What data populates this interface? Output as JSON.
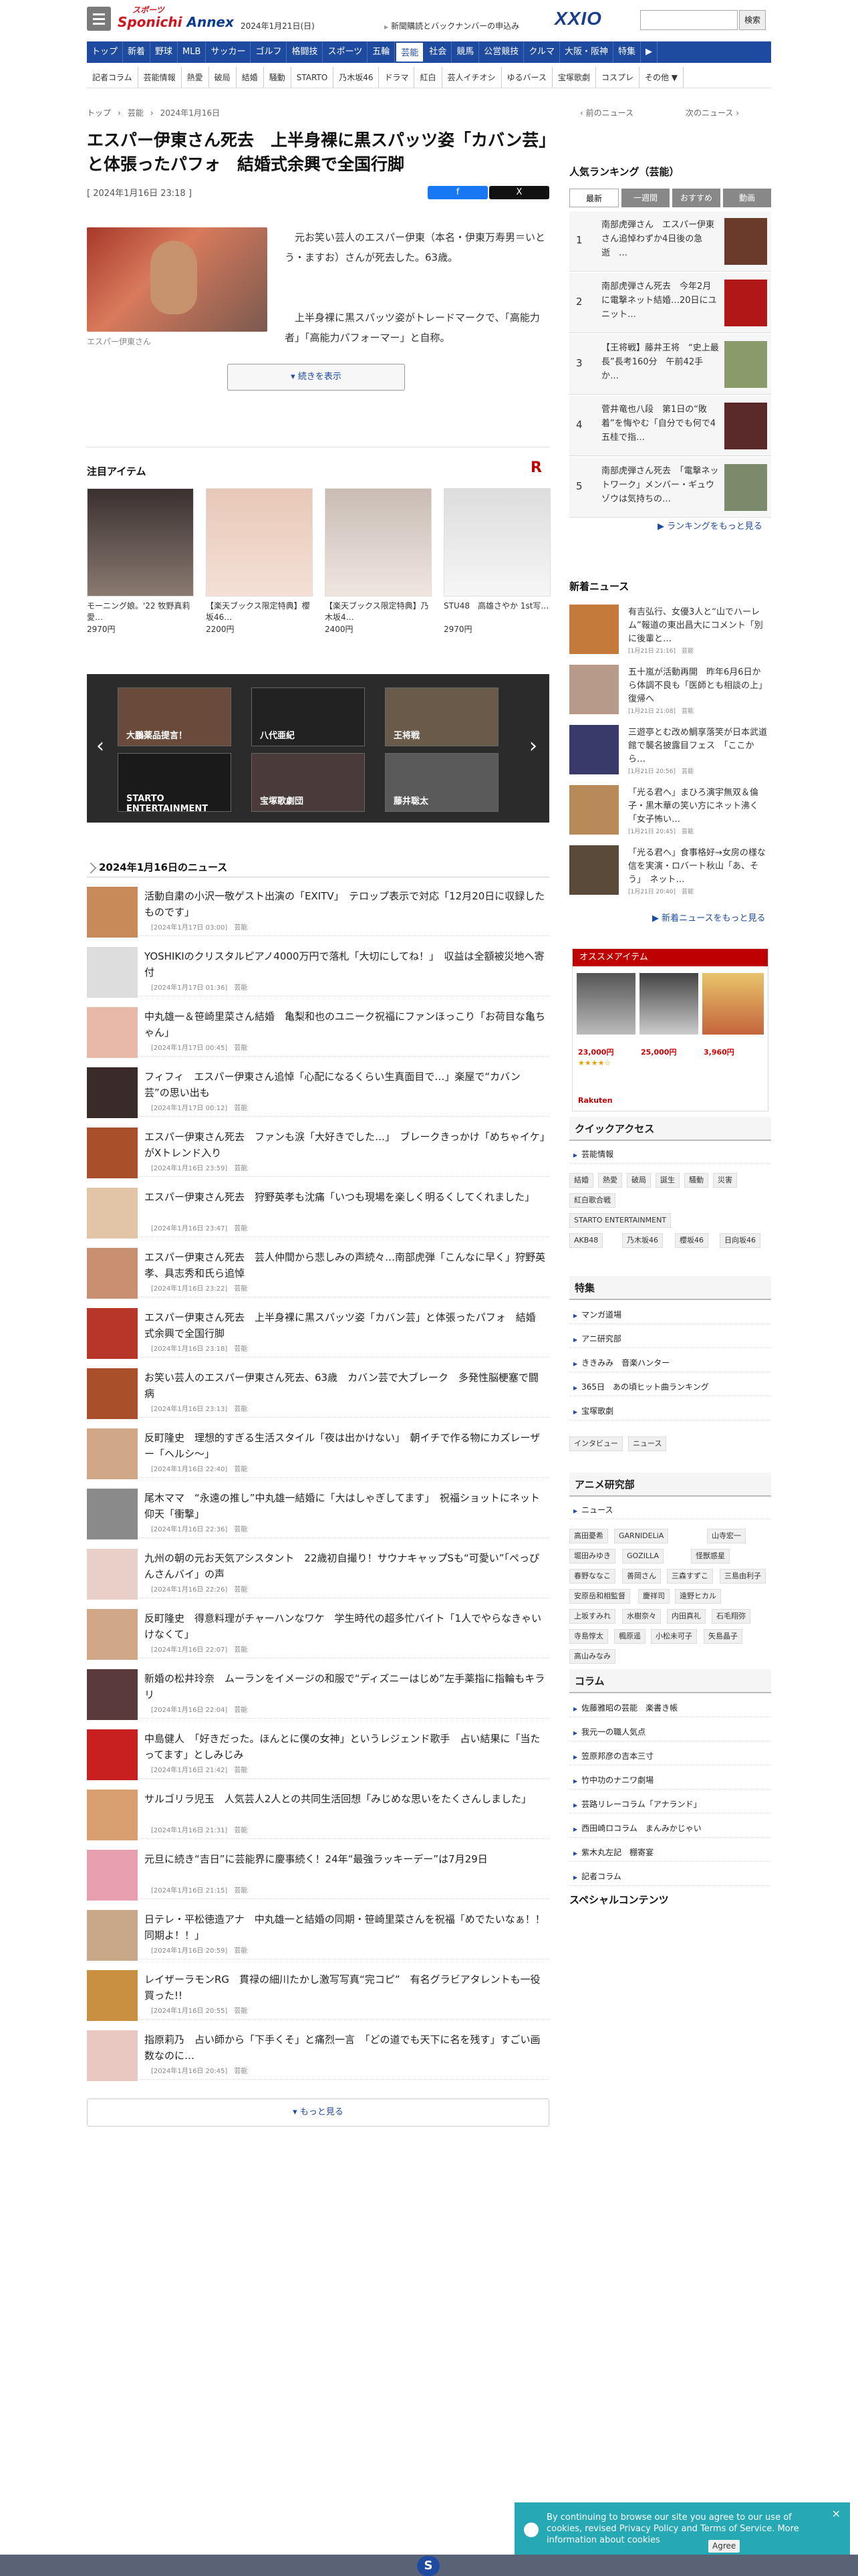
{
  "header": {
    "logo_top": "スポーツ",
    "logo_main_a": "Sponichi",
    "logo_main_b": " Annex",
    "date": "2024年1月21日(日)",
    "paper_link": "新聞購読とバックナンバーの申込み",
    "brand": "XXIO",
    "search_button": "検索"
  },
  "nav": [
    "トップ",
    "新着",
    "野球",
    "MLB",
    "サッカー",
    "ゴルフ",
    "格闘技",
    "スポーツ",
    "五輪",
    "芸能",
    "社会",
    "競馬",
    "公営競技",
    "クルマ",
    "大阪・阪神",
    "特集",
    "▶"
  ],
  "subnav": [
    "記者コラム",
    "芸能情報",
    "熱愛",
    "破局",
    "結婚",
    "騒動",
    "STARTO",
    "乃木坂46",
    "ドラマ",
    "紅白",
    "芸人イチオシ",
    "ゆるバース",
    "宝塚歌劇",
    "コスプレ",
    "その他 ▼"
  ],
  "breadcrumb": [
    "トップ",
    "芸能",
    "2024年1月16日"
  ],
  "prev": "‹ 前のニュース",
  "next": "次のニュース ›",
  "article": {
    "title": "エスパー伊東さん死去　上半身裸に黒スパッツ姿「カバン芸」と体張ったパフォ　結婚式余興で全国行脚",
    "published": "[ 2024年1月16日 23:18 ]",
    "share_fb": "f",
    "share_x": "X",
    "caption": "エスパー伊東さん",
    "para1": "元お笑い芸人のエスパー伊東（本名・伊東万寿男＝いとう・ますお）さんが死去した。63歳。",
    "para2": "上半身裸に黒スパッツ姿がトレードマークで、「高能力者」「高能力パフォーマー」と自称。",
    "more_button": "続きを表示"
  },
  "featured": {
    "title": "注目アイテム",
    "items": [
      {
        "title": "モーニング娘。'22 牧野真莉愛…",
        "price": "2970円"
      },
      {
        "title": "【楽天ブックス限定特典】櫻坂46…",
        "price": "2200円"
      },
      {
        "title": "【楽天ブックス限定特典】乃木坂4…",
        "price": "2400円"
      },
      {
        "title": "STU48　高雄さやか 1st写…",
        "price": "2970円"
      }
    ]
  },
  "carousel": [
    "大鵬薬品提言！",
    "八代亜紀",
    "王将戦",
    "STARTO ENTERTAINMENT",
    "宝塚歌劇団",
    "藤井聡太"
  ],
  "news_list": {
    "title": "2024年1月16日のニュース",
    "items": [
      {
        "title": "活動自粛の小沢一敬ゲスト出演の「EXITV」　テロップ表示で対応「12月20日に収録したものです」",
        "meta": "[2024年1月17日 03:00]　芸能"
      },
      {
        "title": "YOSHIKIのクリスタルピアノ4000万円で落札「大切にしてね！」　収益は全額被災地へ寄付",
        "meta": "[2024年1月17日 01:36]　芸能"
      },
      {
        "title": "中丸雄一＆笹崎里菜さん結婚　亀梨和也のユニーク祝福にファンほっこり「お荷目な亀ちゃん」",
        "meta": "[2024年1月17日 00:45]　芸能"
      },
      {
        "title": "フィフィ　エスパー伊東さん追悼「心配になるくらい生真面目で…」楽屋で“カバン芸”の思い出も",
        "meta": "[2024年1月17日 00:12]　芸能"
      },
      {
        "title": "エスパー伊東さん死去　ファンも涙「大好きでした…」　ブレークきっかけ「めちゃイケ」がXトレンド入り",
        "meta": "[2024年1月16日 23:59]　芸能"
      },
      {
        "title": "エスパー伊東さん死去　狩野英孝も沈痛「いつも現場を楽しく明るくしてくれました」",
        "meta": "[2024年1月16日 23:47]　芸能"
      },
      {
        "title": "エスパー伊東さん死去　芸人仲間から悲しみの声続々…南部虎弾「こんなに早く」狩野英孝、具志秀和氏ら追悼",
        "meta": "[2024年1月16日 23:22]　芸能"
      },
      {
        "title": "エスパー伊東さん死去　上半身裸に黒スパッツ姿「カバン芸」と体張ったパフォ　結婚式余興で全国行脚",
        "meta": "[2024年1月16日 23:18]　芸能"
      },
      {
        "title": "お笑い芸人のエスパー伊東さん死去、63歳　カバン芸で大ブレーク　多発性脳梗塞で闘病",
        "meta": "[2024年1月16日 23:13]　芸能"
      },
      {
        "title": "反町隆史　理想的すぎる生活スタイル「夜は出かけない」　朝イチで作る物にカズレーザー「ヘルシ〜」",
        "meta": "[2024年1月16日 22:40]　芸能"
      },
      {
        "title": "尾木ママ　“永遠の推し”中丸雄一結婚に「大はしゃぎしてます」　祝福ショットにネット仰天「衝撃」",
        "meta": "[2024年1月16日 22:36]　芸能"
      },
      {
        "title": "九州の朝の元お天気アシスタント　22歳初自撮り！サウナキャップSも“可愛い”「ぺっぴんさんバイ」の声",
        "meta": "[2024年1月16日 22:26]　芸能"
      },
      {
        "title": "反町隆史　得意料理がチャーハンなワケ　学生時代の超多忙バイト「1人でやらなきゃいけなくて」",
        "meta": "[2024年1月16日 22:07]　芸能"
      },
      {
        "title": "新婚の松井玲奈　ムーランをイメージの和服で“ディズニーはじめ”左手薬指に指輪もキラリ",
        "meta": "[2024年1月16日 22:04]　芸能"
      },
      {
        "title": "中島健人　「好きだった。ほんとに僕の女神」というレジェンド歌手　占い結果に「当たってます」としみじみ",
        "meta": "[2024年1月16日 21:42]　芸能"
      },
      {
        "title": "サルゴリラ児玉　人気芸人2人との共同生活回想「みじめな思いをたくさんしました」",
        "meta": "[2024年1月16日 21:31]　芸能"
      },
      {
        "title": "元旦に続き“吉日”に芸能界に慶事続く！24年“最強ラッキーデー”は7月29日",
        "meta": "[2024年1月16日 21:15]　芸能"
      },
      {
        "title": "日テレ・平松徳造アナ　中丸雄一と結婚の同期・笹崎里菜さんを祝福「めでたいなぁ！！同期よ！！」",
        "meta": "[2024年1月16日 20:59]　芸能"
      },
      {
        "title": "レイザーラモンRG　貫禄の細川たかし激写写真“完コピ”　有名グラビアタレントも一役買った!!",
        "meta": "[2024年1月16日 20:55]　芸能"
      },
      {
        "title": "指原莉乃　占い師から「下手くそ」と痛烈一言　「どの道でも天下に名を残す」すごい画数なのに…",
        "meta": "[2024年1月16日 20:45]　芸能"
      }
    ],
    "more": "もっと見る"
  },
  "sidebar": {
    "ranking_title": "人気ランキング（芸能）",
    "ranking_tabs": [
      "最新",
      "一週間",
      "おすすめ",
      "動画"
    ],
    "ranking": [
      {
        "n": "1",
        "title": "南部虎弾さん　エスパー伊東さん追悼わずか4日後の急逝　…"
      },
      {
        "n": "2",
        "title": "南部虎弾さん死去　今年2月に電撃ネット結婚…20日にユニット…"
      },
      {
        "n": "3",
        "title": "【王将戦】藤井王将　“史上最長”長考160分　午前42手か…"
      },
      {
        "n": "4",
        "title": "菅井竜也八段　第1日の“敗着”を悔やむ「自分でも何で4五桂で指…"
      },
      {
        "n": "5",
        "title": "南部虎弾さん死去　「電撃ネットワーク」メンバー・ギュウゾウは気持ちの…"
      }
    ],
    "ranking_more": "ランキングをもっと見る",
    "latest_title": "新着ニュース",
    "latest": [
      {
        "title": "有吉弘行、女優3人と“山でハーレム”報道の東出昌大にコメント「別に後輩と…",
        "meta": "[1月21日 21:16]　芸能"
      },
      {
        "title": "五十嵐が活動再開　昨年6月6日から体調不良も「医師とも相談の上」復帰へ",
        "meta": "[1月21日 21:08]　芸能"
      },
      {
        "title": "三遊亭とむ改め鯛享落笑が日本武道館で襲名披露目フェス　「ここから…",
        "meta": "[1月21日 20:56]　芸能"
      },
      {
        "title": "「光る君へ」まひろ演宇無双＆倫子・黒木華の笑い方にネット沸く「女子怖い…",
        "meta": "[1月21日 20:45]　芸能"
      },
      {
        "title": "「光る君へ」食事格好→女房の様な信を実演・ロバート秋山「あ、そう」　ネット…",
        "meta": "[1月21日 20:40]　芸能"
      }
    ],
    "latest_more": "新着ニュースをもっと見る",
    "osusume_title": "オススメアイテム",
    "osusume_prices": [
      "23,000円",
      "25,000円",
      "3,960円"
    ],
    "quick_title": "クイックアクセス",
    "quick_link": "芸能情報",
    "quick_tags": [
      "結婚",
      "熱愛",
      "破局",
      "誕生",
      "騒動",
      "災害",
      "紅白歌合戦",
      "STARTO ENTERTAINMENT",
      "AKB48",
      "乃木坂46",
      "櫻坂46",
      "日向坂46"
    ],
    "tokushu_title": "特集",
    "tokushu": [
      "マンガ道場",
      "アニ研究部",
      "ききみみ　音楽ハンター",
      "365日　あの頃ヒット曲ランキング",
      "宝塚歌劇"
    ],
    "tokushu_tags": [
      "インタビュー",
      "ニュース"
    ],
    "anime_title": "アニメ研究部",
    "anime_link": "ニュース",
    "anime_tags": [
      "高田憂希",
      "GARNIDELiA",
      "山寺宏一",
      "堀田みゆき",
      "GOZILLA",
      "怪獣惑星",
      "春野ななこ",
      "善岡さん",
      "三森すずこ",
      "三島由利子",
      "安原岳和相監督",
      "慶祥司",
      "遠野ヒカル",
      "上坂すみれ",
      "水樹奈々",
      "内田真礼",
      "石毛翔弥",
      "寺島惇太",
      "楓原遥",
      "小松未可子",
      "矢島晶子",
      "高山みなみ"
    ],
    "column_title": "コラム",
    "columns": [
      "佐藤雅昭の芸能　楽書き帳",
      "我元一の職人気点",
      "笠原邦彦の吉本三寸",
      "竹中功のナニワ劇場",
      "芸路リレーコラム「アナランド」",
      "西田崎ロコラム　まんみかじゃい",
      "紫木丸左記　棚寄宴",
      "記者コラム"
    ],
    "special_title": "スペシャルコンテンツ"
  },
  "cookie": {
    "text": "By continuing to browse our site you agree to our use of cookies, revised Privacy Policy and Terms of Service. More information about cookies",
    "agree": "Agree",
    "close": "×"
  },
  "footer_logo": "S"
}
